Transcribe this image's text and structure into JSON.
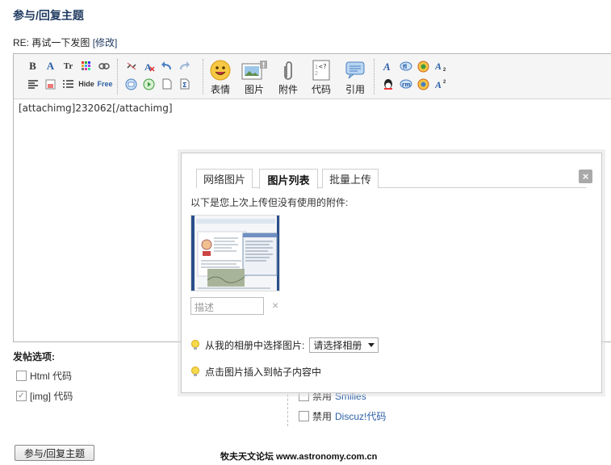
{
  "page": {
    "title": "参与/回复主题",
    "subject_prefix": "RE: 再试一下发图",
    "edit_link": "[修改]"
  },
  "toolbar": {
    "row1_left": [
      "B",
      "A",
      "Tr"
    ],
    "row2_left_text": [
      "Hide",
      "Free"
    ],
    "big_buttons": [
      {
        "label": "表情",
        "icon": "smiley-icon"
      },
      {
        "label": "图片",
        "icon": "image-icon"
      },
      {
        "label": "附件",
        "icon": "paperclip-icon"
      },
      {
        "label": "代码",
        "icon": "code-icon"
      },
      {
        "label": "引用",
        "icon": "quote-icon"
      }
    ]
  },
  "editor": {
    "content": "[attachimg]232062[/attachimg]"
  },
  "popup": {
    "tabs": [
      "网络图片",
      "图片列表",
      "批量上传"
    ],
    "active_tab": "图片列表",
    "close_label": "×",
    "hint": "以下是您上次上传但没有使用的附件:",
    "description_placeholder": "描述",
    "delete_label": "×",
    "album_tip": "从我的相册中选择图片:",
    "album_select": "请选择相册",
    "insert_tip": "点击图片插入到帖子内容中"
  },
  "options": {
    "title": "发帖选项:",
    "html_code": "Html 代码",
    "img_code": "[img] 代码",
    "disable_smilies_prefix": "禁用",
    "disable_smilies": "Smilies",
    "disable_discuz_prefix": "禁用",
    "disable_discuz": "Discuz!代码"
  },
  "submit_label": "参与/回复主题",
  "watermark": "牧夫天文论坛 www.astronomy.com.cn"
}
